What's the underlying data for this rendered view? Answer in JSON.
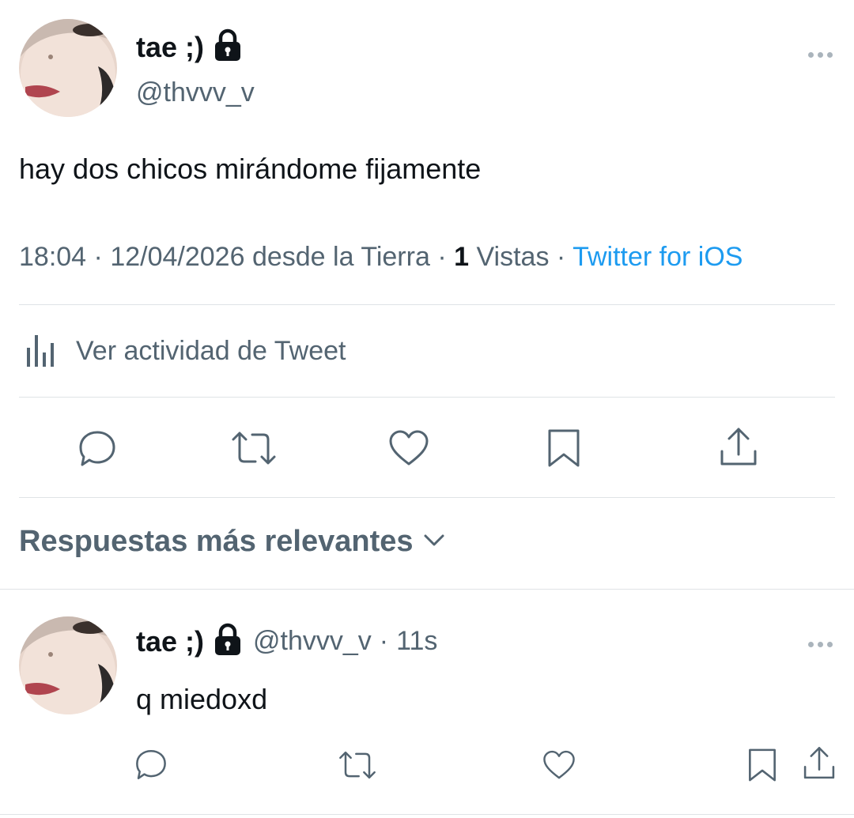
{
  "tweet": {
    "display_name": "tae ;)",
    "handle": "@thvvv_v",
    "text": "hay dos chicos mirándome fijamente",
    "time": "18:04",
    "date": "12/04/2026",
    "location": "desde la Tierra",
    "views_count": "1",
    "views_label": "Vistas",
    "source": "Twitter for iOS",
    "separator": "·"
  },
  "activity": {
    "label": "Ver actividad de Tweet"
  },
  "actions": [
    "reply-icon",
    "retweet-icon",
    "like-icon",
    "bookmark-icon",
    "share-icon"
  ],
  "replies_header": {
    "label": "Respuestas más relevantes"
  },
  "reply": {
    "display_name": "tae ;)",
    "handle": "@thvvv_v",
    "separator": "·",
    "time": "11s",
    "text": "q miedoxd"
  },
  "colors": {
    "text": "#0f1419",
    "secondary": "#536471",
    "link": "#1d9bf0",
    "divider": "#dfe3e6"
  }
}
